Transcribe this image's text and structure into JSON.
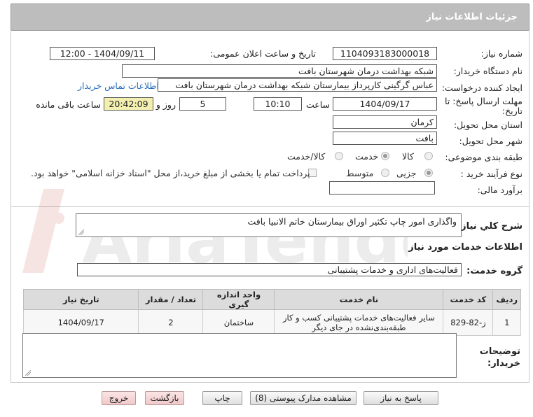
{
  "header": {
    "title": "جزئیات اطلاعات نیاز"
  },
  "form": {
    "need_number": {
      "label": "شماره نیاز:",
      "value": "1104093183000018"
    },
    "announce": {
      "label": "تاریخ و ساعت اعلان عمومی:",
      "value": "1404/09/11 - 12:00"
    },
    "buyer_org": {
      "label": "نام دستگاه خریدار:",
      "value": "شبکه بهداشت درمان شهرستان بافت"
    },
    "creator": {
      "label": "ایجاد کننده درخواست:",
      "value": "عباس  گرگینی کارپرداز بیمارستان شبکه بهداشت درمان شهرستان بافت",
      "contact_link": "اطلاعات تماس خریدار"
    },
    "deadline": {
      "label_line1": "مهلت ارسال پاسخ: تا",
      "label_line2": "تاریخ:",
      "date": "1404/09/17",
      "time_label": "ساعت",
      "time": "10:10",
      "days": "5",
      "days_label": "روز و",
      "remaining": "20:42:09",
      "remaining_label": "ساعت باقی مانده"
    },
    "province": {
      "label": "استان محل تحویل:",
      "value": "کرمان"
    },
    "city": {
      "label": "شهر محل تحویل:",
      "value": "بافت"
    },
    "category": {
      "label": "طبقه بندی موضوعی:",
      "options": [
        "کالا",
        "خدمت",
        "کالا/خدمت"
      ],
      "selected": "خدمت"
    },
    "process": {
      "label": "نوع فرآیند خرید :",
      "options": [
        "جزیی",
        "متوسط"
      ],
      "selected": "جزیی",
      "treasury_note": "پرداخت تمام یا بخشی از مبلغ خرید،از محل \"اسناد خزانه اسلامی\" خواهد بود."
    },
    "estimate": {
      "label": "برآورد مالی:",
      "value": ""
    }
  },
  "details": {
    "summary_label": "شرح کلي نياز:",
    "summary_value": "واگذاری امور چاپ تکثیر اوراق بیمارستان خاتم الانبیا بافت",
    "services_heading": "اطلاعات خدمات مورد نياز",
    "service_group_label": "گروه خدمت:",
    "service_group_value": "فعالیت‌های اداری و خدمات پشتیبانی",
    "table": {
      "headers": [
        "ردیف",
        "کد خدمت",
        "نام خدمت",
        "واحد اندازه گیری",
        "تعداد / مقدار",
        "تاریخ نیاز"
      ],
      "rows": [
        {
          "row": "1",
          "code": "ز-82-829",
          "name": "سایر فعالیت‌های خدمات پشتیبانی کسب و کار طبقه‌بندی‌نشده در جای دیگر",
          "unit": "ساختمان",
          "qty": "2",
          "date": "1404/09/17"
        }
      ]
    },
    "buyer_notes_label": "توضیحات خریدار:",
    "buyer_notes_value": ""
  },
  "buttons": {
    "reply": "پاسخ به نیاز",
    "attachments": "مشاهده مدارک پیوستی (8)",
    "print": "چاپ",
    "back": "بازگشت",
    "exit": "خروج"
  },
  "watermark": {
    "text": "AriaTender.neT"
  }
}
